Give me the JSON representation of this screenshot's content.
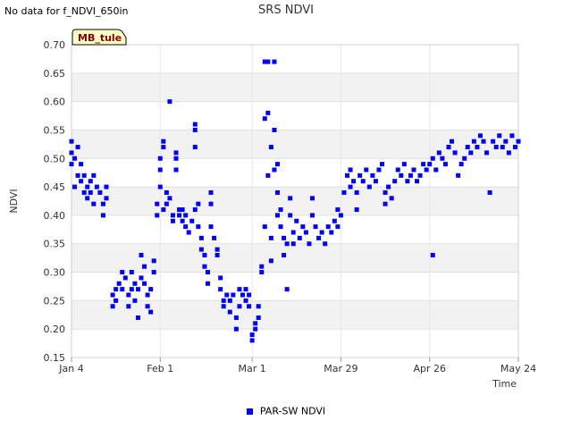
{
  "header": {
    "no_data_text": "No data for f_NDVI_650in"
  },
  "chart_data": {
    "type": "scatter",
    "title": "SRS NDVI",
    "xlabel": "Time",
    "ylabel": "NDVI",
    "site_label": "MB_tule",
    "xlim": [
      "2024-01-04",
      "2024-05-24"
    ],
    "ylim": [
      0.15,
      0.7
    ],
    "yticks": [
      0.15,
      0.2,
      0.25,
      0.3,
      0.35,
      0.4,
      0.45,
      0.5,
      0.55,
      0.6,
      0.65,
      0.7
    ],
    "ytick_labels": [
      "0.15",
      "0.20",
      "0.25",
      "0.30",
      "0.35",
      "0.40",
      "0.45",
      "0.50",
      "0.55",
      "0.60",
      "0.65",
      "0.70"
    ],
    "xticks": [
      "2024-01-04",
      "2024-02-01",
      "2024-03-01",
      "2024-03-29",
      "2024-04-26",
      "2024-05-24"
    ],
    "xtick_labels": [
      "Jan 4",
      "Feb 1",
      "Mar 1",
      "Mar 29",
      "Apr 26",
      "May 24"
    ],
    "grid": "horizontal alternating bands",
    "legend_position": "bottom-center",
    "marker_color": "#0000ff",
    "series": [
      {
        "name": "PAR-SW NDVI",
        "points": [
          [
            "2024-01-04",
            0.53
          ],
          [
            "2024-01-04",
            0.51
          ],
          [
            "2024-01-04",
            0.49
          ],
          [
            "2024-01-05",
            0.5
          ],
          [
            "2024-01-05",
            0.45
          ],
          [
            "2024-01-06",
            0.52
          ],
          [
            "2024-01-06",
            0.47
          ],
          [
            "2024-01-07",
            0.46
          ],
          [
            "2024-01-07",
            0.49
          ],
          [
            "2024-01-08",
            0.44
          ],
          [
            "2024-01-08",
            0.47
          ],
          [
            "2024-01-09",
            0.43
          ],
          [
            "2024-01-09",
            0.45
          ],
          [
            "2024-01-10",
            0.44
          ],
          [
            "2024-01-10",
            0.46
          ],
          [
            "2024-01-11",
            0.42
          ],
          [
            "2024-01-11",
            0.47
          ],
          [
            "2024-01-12",
            0.45
          ],
          [
            "2024-01-13",
            0.44
          ],
          [
            "2024-01-14",
            0.42
          ],
          [
            "2024-01-14",
            0.4
          ],
          [
            "2024-01-15",
            0.43
          ],
          [
            "2024-01-15",
            0.45
          ],
          [
            "2024-01-17",
            0.26
          ],
          [
            "2024-01-17",
            0.24
          ],
          [
            "2024-01-18",
            0.27
          ],
          [
            "2024-01-18",
            0.25
          ],
          [
            "2024-01-19",
            0.28
          ],
          [
            "2024-01-20",
            0.27
          ],
          [
            "2024-01-20",
            0.3
          ],
          [
            "2024-01-21",
            0.29
          ],
          [
            "2024-01-22",
            0.26
          ],
          [
            "2024-01-22",
            0.24
          ],
          [
            "2024-01-23",
            0.27
          ],
          [
            "2024-01-23",
            0.3
          ],
          [
            "2024-01-24",
            0.28
          ],
          [
            "2024-01-24",
            0.25
          ],
          [
            "2024-01-25",
            0.22
          ],
          [
            "2024-01-25",
            0.27
          ],
          [
            "2024-01-26",
            0.29
          ],
          [
            "2024-01-26",
            0.33
          ],
          [
            "2024-01-27",
            0.31
          ],
          [
            "2024-01-27",
            0.28
          ],
          [
            "2024-01-28",
            0.26
          ],
          [
            "2024-01-28",
            0.24
          ],
          [
            "2024-01-29",
            0.27
          ],
          [
            "2024-01-29",
            0.23
          ],
          [
            "2024-01-30",
            0.32
          ],
          [
            "2024-01-30",
            0.3
          ],
          [
            "2024-01-31",
            0.4
          ],
          [
            "2024-01-31",
            0.42
          ],
          [
            "2024-02-01",
            0.48
          ],
          [
            "2024-02-01",
            0.45
          ],
          [
            "2024-02-01",
            0.5
          ],
          [
            "2024-02-02",
            0.52
          ],
          [
            "2024-02-02",
            0.53
          ],
          [
            "2024-02-02",
            0.41
          ],
          [
            "2024-02-03",
            0.44
          ],
          [
            "2024-02-03",
            0.42
          ],
          [
            "2024-02-04",
            0.43
          ],
          [
            "2024-02-04",
            0.6
          ],
          [
            "2024-02-05",
            0.4
          ],
          [
            "2024-02-05",
            0.39
          ],
          [
            "2024-02-06",
            0.48
          ],
          [
            "2024-02-06",
            0.51
          ],
          [
            "2024-02-06",
            0.5
          ],
          [
            "2024-02-07",
            0.41
          ],
          [
            "2024-02-07",
            0.4
          ],
          [
            "2024-02-08",
            0.39
          ],
          [
            "2024-02-08",
            0.41
          ],
          [
            "2024-02-09",
            0.38
          ],
          [
            "2024-02-09",
            0.4
          ],
          [
            "2024-02-10",
            0.37
          ],
          [
            "2024-02-11",
            0.39
          ],
          [
            "2024-02-12",
            0.41
          ],
          [
            "2024-02-12",
            0.55
          ],
          [
            "2024-02-12",
            0.56
          ],
          [
            "2024-02-12",
            0.52
          ],
          [
            "2024-02-13",
            0.42
          ],
          [
            "2024-02-13",
            0.38
          ],
          [
            "2024-02-14",
            0.36
          ],
          [
            "2024-02-14",
            0.34
          ],
          [
            "2024-02-15",
            0.31
          ],
          [
            "2024-02-15",
            0.33
          ],
          [
            "2024-02-16",
            0.3
          ],
          [
            "2024-02-16",
            0.28
          ],
          [
            "2024-02-17",
            0.44
          ],
          [
            "2024-02-17",
            0.42
          ],
          [
            "2024-02-17",
            0.38
          ],
          [
            "2024-02-18",
            0.36
          ],
          [
            "2024-02-19",
            0.34
          ],
          [
            "2024-02-19",
            0.33
          ],
          [
            "2024-02-20",
            0.29
          ],
          [
            "2024-02-20",
            0.27
          ],
          [
            "2024-02-21",
            0.25
          ],
          [
            "2024-02-21",
            0.24
          ],
          [
            "2024-02-22",
            0.26
          ],
          [
            "2024-02-23",
            0.25
          ],
          [
            "2024-02-23",
            0.23
          ],
          [
            "2024-02-24",
            0.26
          ],
          [
            "2024-02-25",
            0.22
          ],
          [
            "2024-02-25",
            0.2
          ],
          [
            "2024-02-26",
            0.24
          ],
          [
            "2024-02-26",
            0.27
          ],
          [
            "2024-02-27",
            0.26
          ],
          [
            "2024-02-28",
            0.25
          ],
          [
            "2024-02-28",
            0.27
          ],
          [
            "2024-02-29",
            0.26
          ],
          [
            "2024-02-29",
            0.24
          ],
          [
            "2024-03-01",
            0.19
          ],
          [
            "2024-03-01",
            0.18
          ],
          [
            "2024-03-02",
            0.2
          ],
          [
            "2024-03-02",
            0.21
          ],
          [
            "2024-03-03",
            0.22
          ],
          [
            "2024-03-03",
            0.24
          ],
          [
            "2024-03-04",
            0.3
          ],
          [
            "2024-03-04",
            0.31
          ],
          [
            "2024-03-05",
            0.67
          ],
          [
            "2024-03-05",
            0.57
          ],
          [
            "2024-03-05",
            0.38
          ],
          [
            "2024-03-06",
            0.67
          ],
          [
            "2024-03-06",
            0.58
          ],
          [
            "2024-03-06",
            0.47
          ],
          [
            "2024-03-07",
            0.52
          ],
          [
            "2024-03-07",
            0.32
          ],
          [
            "2024-03-07",
            0.36
          ],
          [
            "2024-03-08",
            0.67
          ],
          [
            "2024-03-08",
            0.55
          ],
          [
            "2024-03-08",
            0.48
          ],
          [
            "2024-03-09",
            0.49
          ],
          [
            "2024-03-09",
            0.44
          ],
          [
            "2024-03-09",
            0.4
          ],
          [
            "2024-03-10",
            0.41
          ],
          [
            "2024-03-10",
            0.38
          ],
          [
            "2024-03-11",
            0.36
          ],
          [
            "2024-03-11",
            0.33
          ],
          [
            "2024-03-12",
            0.27
          ],
          [
            "2024-03-12",
            0.35
          ],
          [
            "2024-03-13",
            0.43
          ],
          [
            "2024-03-13",
            0.4
          ],
          [
            "2024-03-14",
            0.37
          ],
          [
            "2024-03-14",
            0.35
          ],
          [
            "2024-03-15",
            0.39
          ],
          [
            "2024-03-16",
            0.36
          ],
          [
            "2024-03-17",
            0.38
          ],
          [
            "2024-03-18",
            0.37
          ],
          [
            "2024-03-19",
            0.35
          ],
          [
            "2024-03-20",
            0.43
          ],
          [
            "2024-03-20",
            0.4
          ],
          [
            "2024-03-21",
            0.38
          ],
          [
            "2024-03-22",
            0.36
          ],
          [
            "2024-03-23",
            0.37
          ],
          [
            "2024-03-24",
            0.35
          ],
          [
            "2024-03-25",
            0.38
          ],
          [
            "2024-03-26",
            0.37
          ],
          [
            "2024-03-27",
            0.39
          ],
          [
            "2024-03-28",
            0.38
          ],
          [
            "2024-03-28",
            0.41
          ],
          [
            "2024-03-29",
            0.4
          ],
          [
            "2024-03-30",
            0.44
          ],
          [
            "2024-03-31",
            0.47
          ],
          [
            "2024-04-01",
            0.48
          ],
          [
            "2024-04-01",
            0.45
          ],
          [
            "2024-04-02",
            0.46
          ],
          [
            "2024-04-03",
            0.44
          ],
          [
            "2024-04-03",
            0.41
          ],
          [
            "2024-04-04",
            0.47
          ],
          [
            "2024-04-05",
            0.46
          ],
          [
            "2024-04-06",
            0.48
          ],
          [
            "2024-04-07",
            0.45
          ],
          [
            "2024-04-08",
            0.47
          ],
          [
            "2024-04-09",
            0.46
          ],
          [
            "2024-04-10",
            0.48
          ],
          [
            "2024-04-11",
            0.49
          ],
          [
            "2024-04-12",
            0.44
          ],
          [
            "2024-04-12",
            0.42
          ],
          [
            "2024-04-13",
            0.45
          ],
          [
            "2024-04-14",
            0.43
          ],
          [
            "2024-04-15",
            0.46
          ],
          [
            "2024-04-16",
            0.48
          ],
          [
            "2024-04-17",
            0.47
          ],
          [
            "2024-04-18",
            0.49
          ],
          [
            "2024-04-19",
            0.46
          ],
          [
            "2024-04-20",
            0.47
          ],
          [
            "2024-04-21",
            0.48
          ],
          [
            "2024-04-22",
            0.46
          ],
          [
            "2024-04-23",
            0.47
          ],
          [
            "2024-04-24",
            0.49
          ],
          [
            "2024-04-25",
            0.48
          ],
          [
            "2024-04-26",
            0.49
          ],
          [
            "2024-04-27",
            0.5
          ],
          [
            "2024-04-27",
            0.33
          ],
          [
            "2024-04-28",
            0.48
          ],
          [
            "2024-04-29",
            0.51
          ],
          [
            "2024-04-30",
            0.5
          ],
          [
            "2024-05-01",
            0.49
          ],
          [
            "2024-05-02",
            0.52
          ],
          [
            "2024-05-03",
            0.53
          ],
          [
            "2024-05-04",
            0.51
          ],
          [
            "2024-05-05",
            0.47
          ],
          [
            "2024-05-06",
            0.49
          ],
          [
            "2024-05-07",
            0.5
          ],
          [
            "2024-05-08",
            0.52
          ],
          [
            "2024-05-09",
            0.51
          ],
          [
            "2024-05-10",
            0.53
          ],
          [
            "2024-05-11",
            0.52
          ],
          [
            "2024-05-12",
            0.54
          ],
          [
            "2024-05-13",
            0.53
          ],
          [
            "2024-05-14",
            0.51
          ],
          [
            "2024-05-15",
            0.44
          ],
          [
            "2024-05-16",
            0.53
          ],
          [
            "2024-05-17",
            0.52
          ],
          [
            "2024-05-18",
            0.54
          ],
          [
            "2024-05-19",
            0.52
          ],
          [
            "2024-05-20",
            0.53
          ],
          [
            "2024-05-21",
            0.51
          ],
          [
            "2024-05-22",
            0.54
          ],
          [
            "2024-05-23",
            0.52
          ],
          [
            "2024-05-24",
            0.53
          ]
        ]
      }
    ]
  }
}
